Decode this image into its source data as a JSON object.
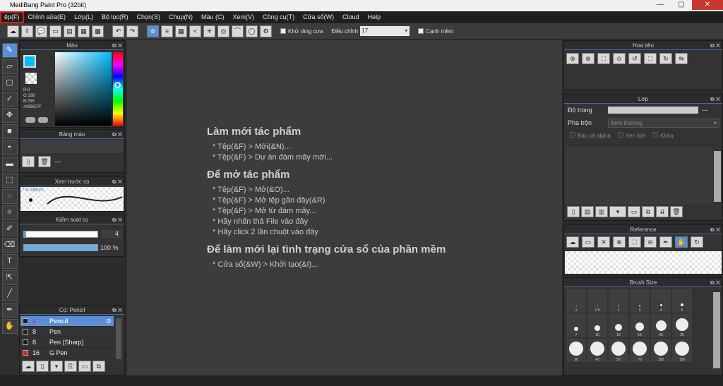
{
  "window": {
    "title": "MediBang Paint Pro (32bit)",
    "controls": [
      "—",
      "▢",
      "✕"
    ]
  },
  "menu": [
    "ệp(F)",
    "Chỉnh sửa(E)",
    "Lớp(L)",
    "Bộ lọc(R)",
    "Chọn(S)",
    "Chụp(N)",
    "Màu (C)",
    "Xem(V)",
    "Công cụ(T)",
    "Cửa sổ(W)",
    "Cloud",
    "Help"
  ],
  "toolbar": {
    "antialias_label": "Khử răng cưa",
    "adjust_label": "Điều chỉnh",
    "adjust_value": "17",
    "edge_label": "Cạnh mềm"
  },
  "color_panel": {
    "title": "Màu",
    "r": "R:0",
    "g": "G:188",
    "b": "B:255",
    "hex": "#00BCFF",
    "fg_color": "#00bcff"
  },
  "palette_panel": {
    "title": "Bảng màu",
    "dashes": "---"
  },
  "brush_preview": {
    "title": "Xem trước cọ",
    "size": "0.29mm"
  },
  "brush_control": {
    "title": "Kiểm soát cọ",
    "size_value": "4",
    "opacity_value": "100 %",
    "opacity_fraction": 1.0
  },
  "brush_list": {
    "title": "Cọ: Pencil",
    "items": [
      {
        "size": "4",
        "name": "Pencil",
        "color": "#1e1e1e"
      },
      {
        "size": "8",
        "name": "Pen",
        "color": "#1e1e1e"
      },
      {
        "size": "8",
        "name": "Pen (Sharp)",
        "color": "#1e1e1e"
      },
      {
        "size": "16",
        "name": "G Pen",
        "color": "#e02020"
      }
    ]
  },
  "welcome": {
    "h1": "Làm mới tác phẩm",
    "new_items": [
      "* Tệp(&F) > Mới(&N)...",
      "* Tệp(&F) > Dự án đám mây mới..."
    ],
    "h2": "Để mở tác phẩm",
    "open_items": [
      "* Tệp(&F) > Mở(&O)...",
      "* Tệp(&F) > Mở tệp gần đây(&R)",
      "* Tệp(&F) > Mở từ đám mây...",
      "* Hãy nhấn thả File vào đây",
      "* Hãy click 2 lần chuột vào đây"
    ],
    "h3": "Để làm mới lại tình trạng cửa sổ của phần mềm",
    "reset_items": [
      "* Cửa sổ(&W) > Khởi tạo(&I)..."
    ]
  },
  "navigator": {
    "title": "Hoa tiêu"
  },
  "layer": {
    "title": "Lớp",
    "opacity_label": "Độ trong",
    "opacity_value": "---",
    "blend_label": "Pha trộn",
    "blend_value": "Bình thường",
    "protect_alpha": "Bảo vệ alpha",
    "clipping": "Xén bớt",
    "lock": "Khóa"
  },
  "reference": {
    "title": "Reference"
  },
  "brush_size": {
    "title": "Brush Size",
    "sizes": [
      "1",
      "1.5",
      "2",
      "3",
      "4",
      "5",
      "7",
      "10",
      "12",
      "15",
      "20",
      "25",
      "30",
      "40",
      "50",
      "70",
      "100",
      "150"
    ]
  }
}
